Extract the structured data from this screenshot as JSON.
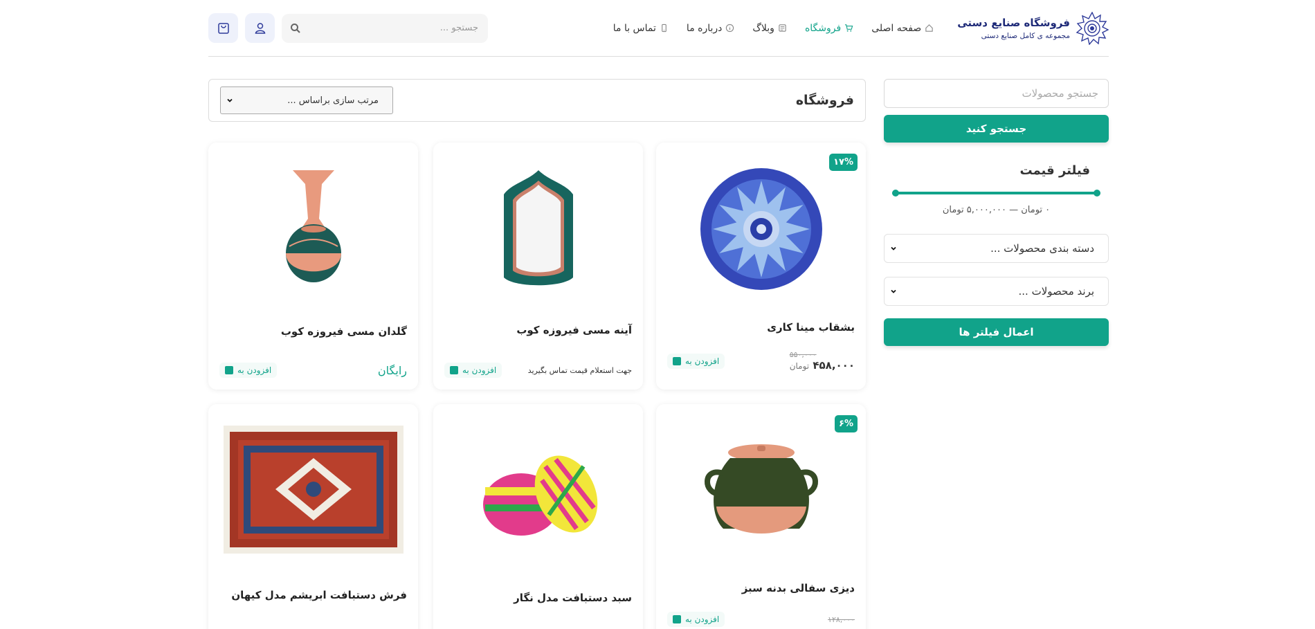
{
  "header": {
    "brand_title": "فروشگاه صنایع دستی",
    "brand_sub": "مجموعه ی کامل صنایع دستی",
    "nav": [
      {
        "label": "صفحه اصلی",
        "icon": "home-icon"
      },
      {
        "label": "فروشگاه",
        "icon": "cart-icon"
      },
      {
        "label": "وبلاگ",
        "icon": "blog-icon"
      },
      {
        "label": "درباره ما",
        "icon": "info-icon"
      },
      {
        "label": "تماس با ما",
        "icon": "phone-icon"
      }
    ],
    "search_placeholder": "جستجو ..."
  },
  "sidebar": {
    "search_placeholder": "جستجو محصولات",
    "search_button": "جستجو کنید",
    "filter_title": "فیلتر قیمت",
    "price_range": "۰ تومان — ۵,۰۰۰,۰۰۰ تومان",
    "category_select": "دسته بندی محصولات ...",
    "brand_select": "برند محصولات ...",
    "apply_button": "اعمال فیلتر ها"
  },
  "main": {
    "title": "فروشگاه",
    "sort_select": "مرتب سازی براساس ..."
  },
  "products": [
    {
      "name": "بشقاب مینا کاری",
      "badge": "۱۷%",
      "old_price": "۵۵۰,۰۰۰",
      "price": "۴۵۸,۰۰۰",
      "currency": "تومان",
      "add_label": "افزودن به"
    },
    {
      "name": "آینه مسی فیروزه کوب",
      "price_note": "جهت استعلام قیمت تماس بگیرید",
      "add_label": "افزودن به"
    },
    {
      "name": "گلدان مسی فیروزه کوب",
      "free_label": "رایگان",
      "add_label": "افزودن به"
    },
    {
      "name": "دیزی سفالی بدنه سبز",
      "badge": "۶%",
      "old_price": "۱۲۸,۰۰۰",
      "add_label": "افزودن به"
    },
    {
      "name": "سبد دستبافت مدل نگار"
    },
    {
      "name": "فرش دستبافت ابریشم مدل کیهان"
    }
  ],
  "colors": {
    "accent": "#11a38a",
    "brand": "#1e2a78"
  }
}
